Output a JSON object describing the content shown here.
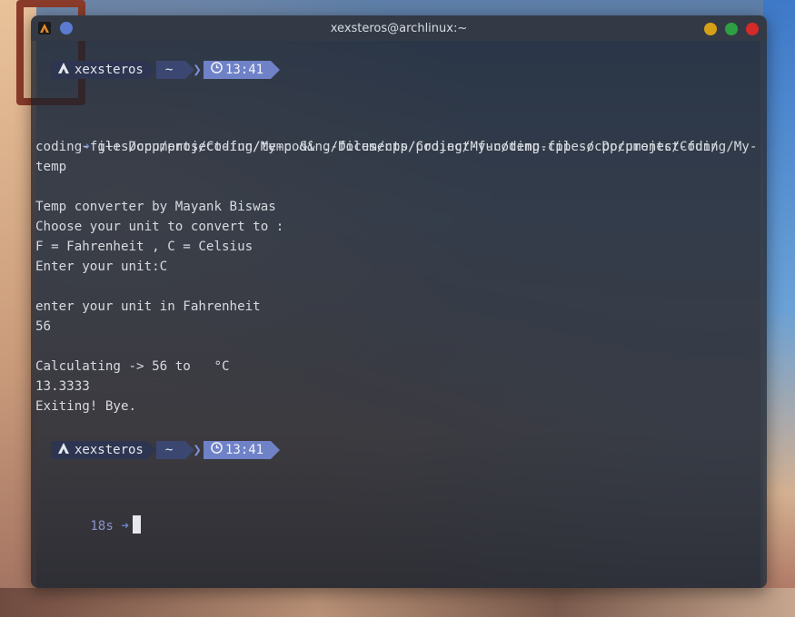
{
  "window": {
    "title": "xexsteros@archlinux:~"
  },
  "prompt1": {
    "user": "xexsteros",
    "dir": "~",
    "time": "13:41"
  },
  "command": {
    "arrow": "➜",
    "line1": "g++ Documents/Coding/My-coding-files/cpp/project-fun/temp.cpp -o Documents/Coding/My-",
    "line2": "coding-files/cpp/project-fun/temp && ./Documents/Coding/My-coding-files/cpp/project-fun/",
    "line3": "temp"
  },
  "output": [
    "Temp converter by Mayank Biswas",
    "Choose your unit to convert to :",
    "F = Fahrenheit , C = Celsius",
    "Enter your unit:C",
    "",
    "enter your unit in Fahrenheit",
    "56",
    "",
    "Calculating -> 56 to   °C",
    "13.3333",
    "Exiting! Bye."
  ],
  "prompt2": {
    "user": "xexsteros",
    "dir": "~",
    "time": "13:41"
  },
  "input_line": {
    "duration": "18s",
    "arrow": "➜"
  },
  "colors": {
    "accent": "#6f82c8",
    "terminal_bg": "#1a202c"
  }
}
